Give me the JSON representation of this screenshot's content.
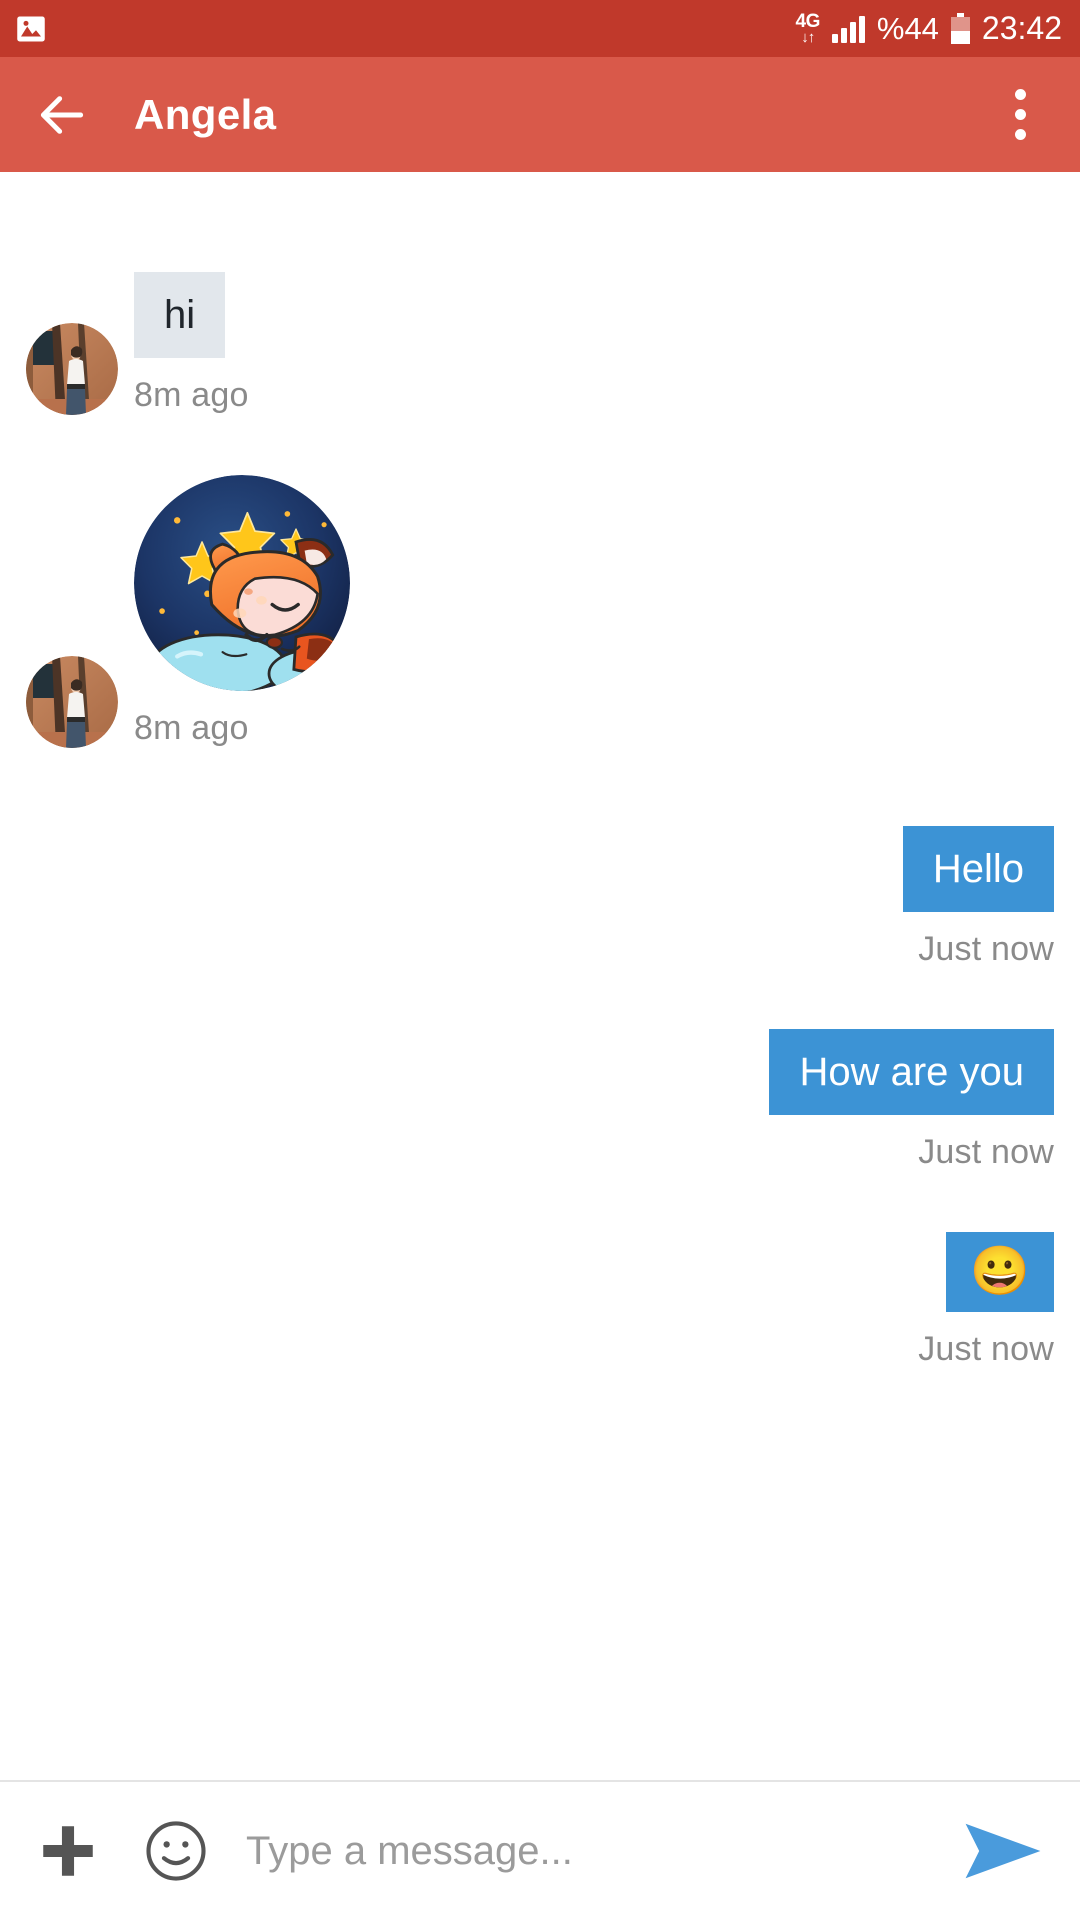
{
  "status_bar": {
    "left_icon": "photo-icon",
    "network_type": "4G",
    "data_arrows": "↓↑",
    "signal_icon": "signal-bars-icon",
    "battery_percent": "%44",
    "battery_icon": "battery-icon",
    "clock": "23:42"
  },
  "app_bar": {
    "back_icon": "back-arrow-icon",
    "title": "Angela",
    "overflow_icon": "overflow-menu-icon"
  },
  "chat": {
    "messages": [
      {
        "direction": "in",
        "type": "text",
        "avatar": "contact-avatar-photo",
        "text": "hi",
        "time": "8m ago"
      },
      {
        "direction": "in",
        "type": "sticker",
        "avatar": "contact-avatar-photo",
        "sticker": "sleeping-fox-sticker",
        "time": "8m ago"
      },
      {
        "direction": "out",
        "type": "text",
        "text": "Hello",
        "time": "Just now"
      },
      {
        "direction": "out",
        "type": "text",
        "text": "How are you",
        "time": "Just now"
      },
      {
        "direction": "out",
        "type": "emoji",
        "text": "😀",
        "time": "Just now"
      }
    ]
  },
  "input_bar": {
    "attach_icon": "plus-icon",
    "emoji_icon": "emoji-face-icon",
    "placeholder": "Type a message...",
    "value": "",
    "send_icon": "send-arrow-icon"
  },
  "colors": {
    "status_bar": "#c0392b",
    "app_bar": "#d9594a",
    "incoming_bubble": "#e2e7ec",
    "outgoing_bubble": "#3c93d5",
    "timestamp": "#8a8a8a",
    "send_arrow": "#4a9bdc"
  }
}
